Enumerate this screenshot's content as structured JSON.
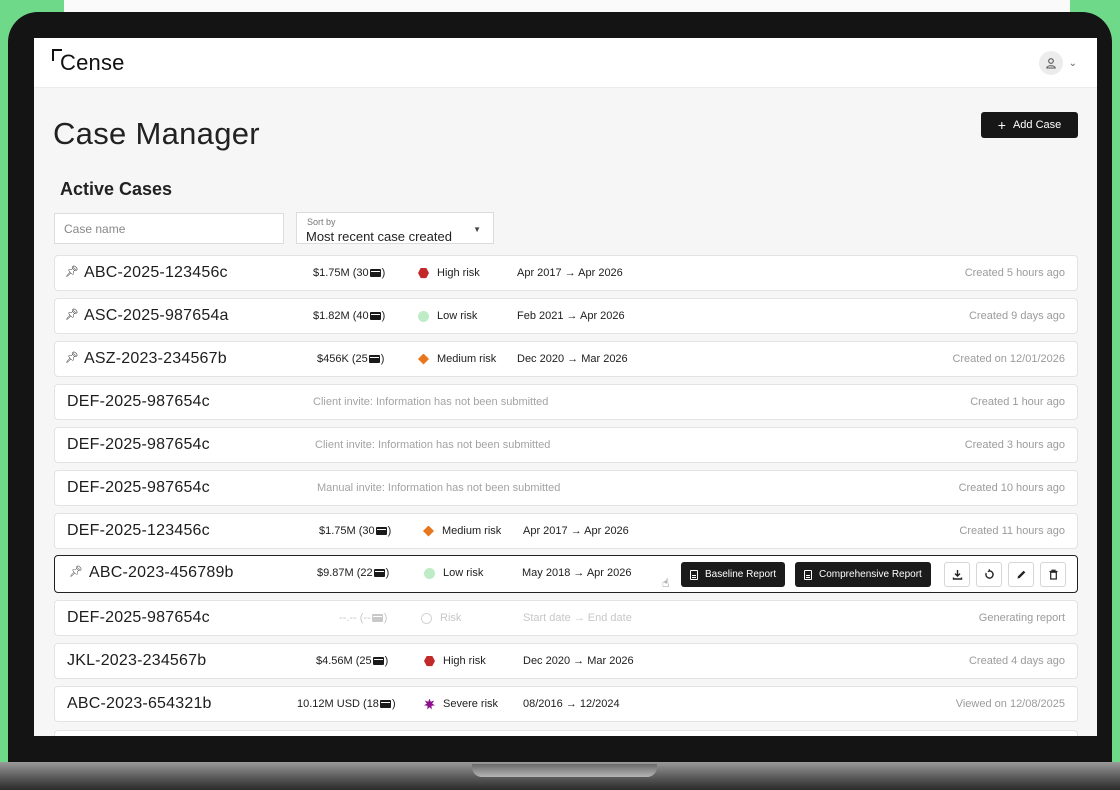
{
  "app": {
    "logo_text": "Cense"
  },
  "header": {
    "title": "Case Manager",
    "add_case_label": "Add Case"
  },
  "section": {
    "title": "Active Cases"
  },
  "filters": {
    "search_placeholder": "Case name",
    "sort_label": "Sort by",
    "sort_value": "Most recent case created"
  },
  "actions": {
    "baseline_report": "Baseline Report",
    "comprehensive_report": "Comprehensive Report"
  },
  "cases": [
    {
      "pinned": true,
      "id": "ABC-2025-123456c",
      "amount": "$1.75M (30",
      "amount_end": ")",
      "risk": "High risk",
      "risk_shape": "hex",
      "dates": "Apr 2017 → Apr 2026",
      "meta": "Created 5 hours ago"
    },
    {
      "pinned": true,
      "id": "ASC-2025-987654a",
      "amount": "$1.82M (40",
      "amount_end": ")",
      "risk": "Low risk",
      "risk_shape": "dot",
      "dates": "Feb 2021 → Apr 2026",
      "meta": "Created 9 days ago"
    },
    {
      "pinned": true,
      "id": "ASZ-2023-234567b",
      "amount": "$456K (25",
      "amount_end": ")",
      "risk": "Medium risk",
      "risk_shape": "diamond",
      "dates": "Dec 2020 → Mar 2026",
      "meta": "Created on 12/01/2026"
    },
    {
      "pinned": false,
      "id": "DEF-2025-987654c",
      "invite": "Client invite: Information has not been submitted",
      "meta": "Created 1 hour ago"
    },
    {
      "pinned": false,
      "id": "DEF-2025-987654c",
      "invite": "Client invite: Information has not been submitted",
      "meta": "Created 3 hours ago"
    },
    {
      "pinned": false,
      "id": "DEF-2025-987654c",
      "invite": "Manual invite: Information has not been submitted",
      "meta": "Created 10 hours ago"
    },
    {
      "pinned": false,
      "id": "DEF-2025-123456c",
      "amount": "$1.75M (30",
      "amount_end": ")",
      "risk": "Medium risk",
      "risk_shape": "diamond",
      "dates": "Apr 2017 → Apr 2026",
      "meta": "Created 11 hours ago"
    },
    {
      "pinned": true,
      "id": "ABC-2023-456789b",
      "amount": "$9.87M (22",
      "amount_end": ")",
      "risk": "Low risk",
      "risk_shape": "dot",
      "dates": "May 2018 → Apr 2026",
      "selected": true
    },
    {
      "pinned": false,
      "id": "DEF-2025-987654c",
      "amount": "--.-- (--",
      "amount_end": ")",
      "risk": "Risk",
      "risk_shape": "ring",
      "dates": "Start date → End date",
      "meta": "Generating report",
      "generating": true
    },
    {
      "pinned": false,
      "id": "JKL-2023-234567b",
      "amount": "$4.56M (25",
      "amount_end": ")",
      "risk": "High risk",
      "risk_shape": "hex",
      "dates": "Dec 2020 → Mar 2026",
      "meta": "Created 4 days ago"
    },
    {
      "pinned": false,
      "id": "ABC-2023-654321b",
      "amount": "10.12M USD (18",
      "amount_end": ")",
      "risk": "Severe risk",
      "risk_shape": "star",
      "dates": "08/2016 → 12/2024",
      "meta": "Viewed on 12/08/2025"
    }
  ]
}
